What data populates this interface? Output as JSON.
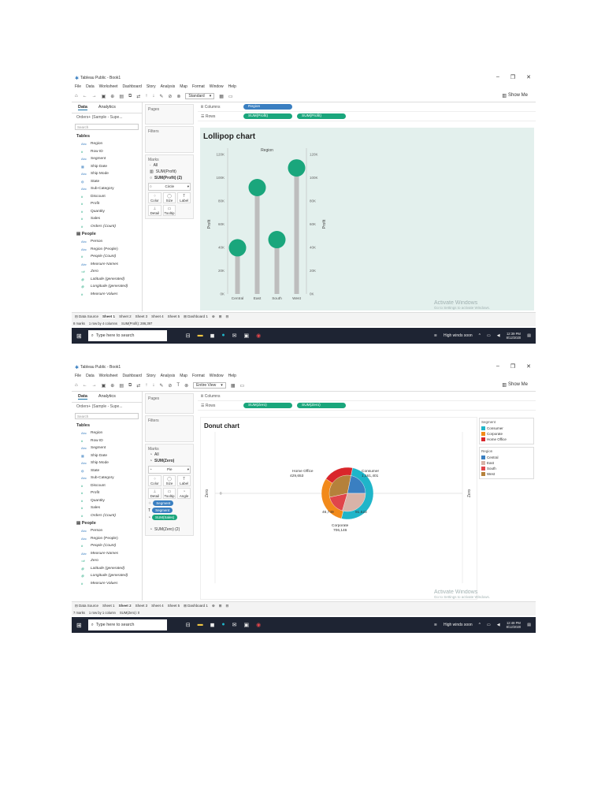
{
  "screens": [
    {
      "title": "Tableau Public - Book1",
      "menu": [
        "File",
        "Data",
        "Worksheet",
        "Dashboard",
        "Story",
        "Analysis",
        "Map",
        "Format",
        "Window",
        "Help"
      ],
      "fit": "Standard",
      "showme": "Show Me",
      "data_tabs": [
        "Data",
        "Analytics"
      ],
      "datasource": "Orders+ (Sample - Supe...",
      "search_placeholder": "Search",
      "tables_header": "Tables",
      "fields": [
        "Region",
        "Row ID",
        "Segment",
        "Ship Date",
        "Ship Mode",
        "State",
        "Sub-Category",
        "Discount",
        "Profit",
        "Quantity",
        "Sales",
        "Orders (Count)"
      ],
      "people_header": "People",
      "people_fields": [
        "Person",
        "Region (People)",
        "People (Count)"
      ],
      "extra_fields": [
        "Measure Names",
        "Zero",
        "Latitude (generated)",
        "Longitude (generated)",
        "Measure Values"
      ],
      "pages": "Pages",
      "filters": "Filters",
      "marks": "Marks",
      "marks_rows": [
        "All",
        "SUM(Profit)",
        "SUM(Profit) (2)"
      ],
      "mark_type": "Circle",
      "mark_buttons": [
        "Color",
        "Size",
        "Label",
        "Detail",
        "Tooltip"
      ],
      "columns_label": "Columns",
      "rows_label": "Rows",
      "columns_pills": [
        "Region"
      ],
      "rows_pills": [
        "SUM(Profit)",
        "SUM(Profit)"
      ],
      "viz_title": "Lollipop chart",
      "tabs": [
        "Data Source",
        "Sheet 1",
        "Sheet 2",
        "Sheet 3",
        "Sheet 4",
        "Sheet 5",
        "Dashboard 1"
      ],
      "active_tab": "Sheet 1",
      "status": [
        "8 marks",
        "1 row by 4 columns",
        "SUM(Profit): 286,397"
      ],
      "activate": "Activate Windows",
      "activate_sub": "Go to Settings to activate Windows.",
      "taskbar_search": "Type here to search",
      "weather": "High winds soon",
      "time": "12:39 PM",
      "date": "8/12/2020"
    },
    {
      "title": "Tableau Public - Book1",
      "menu": [
        "File",
        "Data",
        "Worksheet",
        "Dashboard",
        "Story",
        "Analysis",
        "Map",
        "Format",
        "Window",
        "Help"
      ],
      "fit": "Entire View",
      "showme": "Show Me",
      "data_tabs": [
        "Data",
        "Analytics"
      ],
      "datasource": "Orders+ (Sample - Supe...",
      "search_placeholder": "Search",
      "tables_header": "Tables",
      "fields": [
        "Region",
        "Row ID",
        "Segment",
        "Ship Date",
        "Ship Mode",
        "State",
        "Sub-Category",
        "Discount",
        "Profit",
        "Quantity",
        "Sales",
        "Orders (Count)"
      ],
      "people_header": "People",
      "people_fields": [
        "Person",
        "Region (People)",
        "People (Count)"
      ],
      "extra_fields": [
        "Measure Names",
        "Zero",
        "Latitude (generated)",
        "Longitude (generated)",
        "Measure Values"
      ],
      "pages": "Pages",
      "filters": "Filters",
      "marks": "Marks",
      "marks_rows": [
        "All",
        "SUM(Zero)"
      ],
      "marks_rows_bottom": "SUM(Zero) (2)",
      "mark_type": "Pie",
      "mark_buttons": [
        "Color",
        "Size",
        "Label",
        "Detail",
        "Tooltip",
        "Angle"
      ],
      "mark_pills": [
        "Segment",
        "Segment",
        "SUM(Sales)"
      ],
      "columns_label": "Columns",
      "rows_label": "Rows",
      "columns_pills": [],
      "rows_pills": [
        "SUM(Zero)",
        "SUM(Zero)"
      ],
      "viz_title": "Donut chart",
      "tabs": [
        "Data Source",
        "Sheet 1",
        "Sheet 2",
        "Sheet 3",
        "Sheet 4",
        "Sheet 5",
        "Dashboard 1"
      ],
      "active_tab": "Sheet 2",
      "status": [
        "7 marks",
        "1 row by 1 column",
        "SUM(Zero): 0"
      ],
      "activate": "Activate Windows",
      "activate_sub": "Go to Settings to activate Windows.",
      "taskbar_search": "Type here to search",
      "weather": "High winds soon",
      "time": "12:48 PM",
      "date": "8/12/2020",
      "legend_segment_title": "Segment",
      "legend_segment": [
        {
          "label": "Consumer",
          "color": "#1fb5c9"
        },
        {
          "label": "Corporate",
          "color": "#f28a1a"
        },
        {
          "label": "Home Office",
          "color": "#d9262b"
        }
      ],
      "legend_region_title": "Region",
      "legend_region": [
        {
          "label": "Central",
          "color": "#3a7fc1"
        },
        {
          "label": "East",
          "color": "#d8b3a8"
        },
        {
          "label": "South",
          "color": "#e0454a"
        },
        {
          "label": "West",
          "color": "#b5813b"
        }
      ]
    }
  ],
  "chart_data": [
    {
      "type": "lollipop",
      "title": "Lollipop chart",
      "xlabel": "Region",
      "ylabel": "Profit",
      "categories": [
        "Central",
        "East",
        "South",
        "West"
      ],
      "values": [
        39706,
        91523,
        46749,
        108418
      ],
      "ylim": [
        0,
        120000
      ],
      "yticks": [
        "0K",
        "20K",
        "40K",
        "60K",
        "80K",
        "100K",
        "120K"
      ],
      "y2ticks": [
        "0K",
        "20K",
        "40K",
        "60K",
        "80K",
        "100K",
        "120K"
      ]
    },
    {
      "type": "donut",
      "title": "Donut chart",
      "ylabel": "Zero",
      "outer_series": "Segment",
      "outer": [
        {
          "label": "Consumer",
          "value": 1161401,
          "color": "#1fb5c9"
        },
        {
          "label": "Corporate",
          "value": 706146,
          "color": "#f28a1a"
        },
        {
          "label": "Home Office",
          "value": 429653,
          "color": "#d9262b"
        }
      ],
      "outer_labels": [
        "Consumer",
        "1,161,401",
        "Corporate",
        "706,146",
        "Home Office",
        "429,653"
      ],
      "inner_labels": [
        "91,523",
        "46,749"
      ],
      "inner_series": "Region",
      "inner": [
        {
          "label": "Central",
          "value": 501240,
          "color": "#3a7fc1"
        },
        {
          "label": "East",
          "value": 678781,
          "color": "#d8b3a8"
        },
        {
          "label": "South",
          "value": 391722,
          "color": "#e0454a"
        },
        {
          "label": "West",
          "value": 725458,
          "color": "#b5813b"
        }
      ],
      "ytick": "0"
    }
  ]
}
